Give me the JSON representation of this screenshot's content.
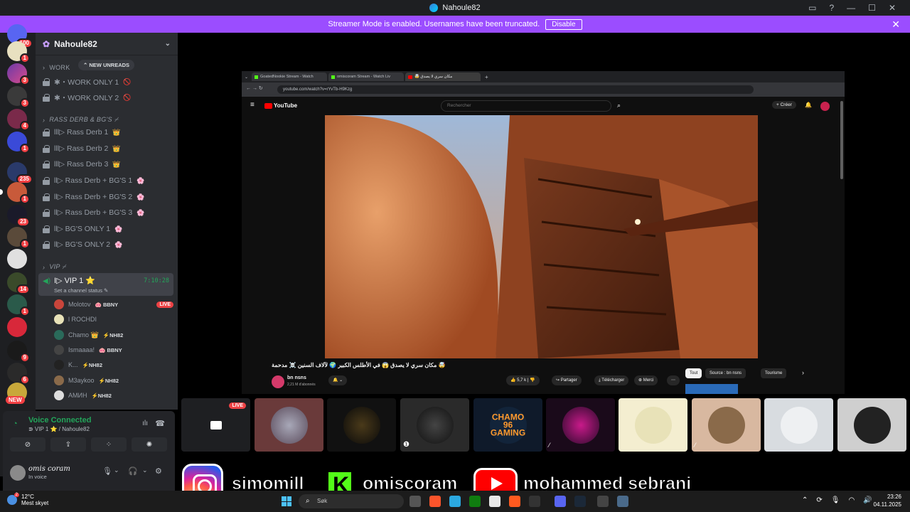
{
  "window": {
    "title": "Nahoule82",
    "controls": [
      "▭",
      "?",
      "—",
      "☐",
      "✕"
    ]
  },
  "banner": {
    "message": "Streamer Mode is enabled. Usernames have been truncated.",
    "disable_label": "Disable",
    "close": "✕"
  },
  "servers": {
    "top_badge": "100",
    "new_label": "NEW",
    "badges": [
      "1",
      "3",
      "3",
      "4",
      "1",
      "235",
      "1",
      "23",
      "1",
      "14",
      "1",
      "9",
      "6"
    ]
  },
  "guild": {
    "name": "Nahoule82",
    "new_unreads": "⌃ NEW UNREADS",
    "categories": {
      "work": "WORK",
      "rass": "RASS DERB & BG'S ⌿",
      "vip": "VIP ⌿"
    },
    "channels": [
      {
        "label": "✱・WORK ONLY 1",
        "emoji": "🚫"
      },
      {
        "label": "✱・WORK ONLY 2",
        "emoji": "🚫"
      },
      {
        "label": "lll▷ Rass Derb 1",
        "emoji": "👑"
      },
      {
        "label": "lll▷ Rass Derb 2",
        "emoji": "👑"
      },
      {
        "label": "lll▷ Rass Derb 3",
        "emoji": "👑"
      },
      {
        "label": "ll▷ Rass Derb + BG'S 1",
        "emoji": "🌸"
      },
      {
        "label": "ll▷ Rass Derb + BG'S 2",
        "emoji": "🌸"
      },
      {
        "label": "ll▷ Rass Derb + BG'S 3",
        "emoji": "🌸"
      },
      {
        "label": "ll▷ BG'S ONLY 1",
        "emoji": "🌸"
      },
      {
        "label": "ll▷ BG'S ONLY 2",
        "emoji": "🌸"
      }
    ],
    "voice_channel": {
      "name": "I▷ VIP 1 ⭐",
      "status": "Set a channel status ✎",
      "timer": "7:10:28"
    },
    "voice_users": [
      {
        "name": "Molotov",
        "tag": "🐽 BBNY",
        "live": "LIVE",
        "color": "#c9453b"
      },
      {
        "name": "l ROCHDI",
        "tag": "",
        "live": "",
        "color": "#e8e2b8"
      },
      {
        "name": "Chamo 👑",
        "tag": "⚡NH82",
        "live": "",
        "color": "#2a6a5a"
      },
      {
        "name": "Ismaaaa!",
        "tag": "🐽 BBNY",
        "live": "",
        "color": "#444"
      },
      {
        "name": "K...",
        "tag": "⚡NH82",
        "live": "",
        "color": "#222"
      },
      {
        "name": "M3aykoo",
        "tag": "⚡NH82",
        "live": "",
        "color": "#8a6a4a"
      },
      {
        "name": "АМИН",
        "tag": "⚡NH82",
        "live": "",
        "color": "#ddd"
      }
    ]
  },
  "voice_panel": {
    "status": "Voice Connected",
    "location": "⋑ VIP 1 ⭐ / Nahoule82",
    "user_name": "omis coram",
    "user_status": "In voice",
    "buttons": [
      "⊘",
      "⇪",
      "⁘",
      "✺"
    ]
  },
  "browser": {
    "tabs": [
      "GoatedNookie Stream - Watch",
      "omiscoram Stream - Watch Liv",
      "🤯 مكان سري لا يصدق"
    ],
    "url": "youtube.com/watch?v=rYvTb-H9Kzg",
    "yt_brand": "YouTube",
    "search_placeholder": "Rechercher",
    "create_label": "+ Créer",
    "video_title": "🤯 مكان سري لا يصدق 😱 في الأطلس الكبير 🌍 لآلاف السنين ☠️ مدحمة",
    "channel_name": "bn nsns",
    "channel_subs": "2,21 M d'abonnés",
    "actions": [
      "👍 5,7 k | 👎",
      "↪ Partager",
      "⤓ Télécharger",
      "⊕ Merci",
      "⋯"
    ],
    "chips": [
      "Tout",
      "Source : bn nsns",
      "Tourisme",
      "›"
    ]
  },
  "thumbnails": {
    "live_label": "LIVE",
    "chamo_label": "CHAMO 96 GAMING"
  },
  "socials": [
    "simomill",
    "omiscoram",
    "mohammed sebrani"
  ],
  "taskbar": {
    "temperature": "12°C",
    "weather": "Mest skyet",
    "weather_badge": "2",
    "search": "Søk",
    "time": "23:26",
    "date": "04.11.2025"
  },
  "colors": {
    "banner": "#9b4dff",
    "discord_bg": "#2b2d31",
    "server_bg": "#1e1f22",
    "voice_green": "#23a55a",
    "live_red": "#ed4245",
    "kick_green": "#53fc18",
    "youtube_red": "#ff0000"
  }
}
